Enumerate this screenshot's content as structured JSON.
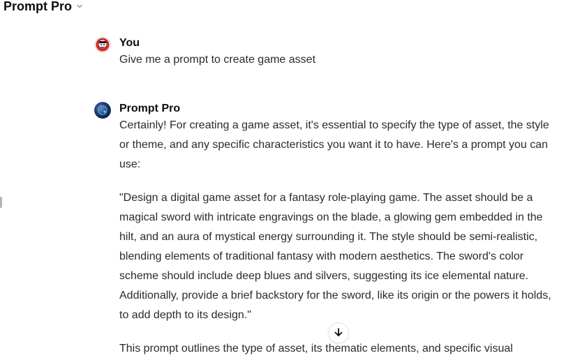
{
  "header": {
    "model_name": "Prompt Pro"
  },
  "messages": {
    "user": {
      "author": "You",
      "text": "Give me a prompt to create game asset"
    },
    "assistant": {
      "author": "Prompt Pro",
      "paragraphs": [
        "Certainly! For creating a game asset, it's essential to specify the type of asset, the style or theme, and any specific characteristics you want it to have. Here's a prompt you can use:",
        "\"Design a digital game asset for a fantasy role-playing game. The asset should be a magical sword with intricate engravings on the blade, a glowing gem embedded in the hilt, and an aura of mystical energy surrounding it. The style should be semi-realistic, blending elements of traditional fantasy with modern aesthetics. The sword's color scheme should include deep blues and silvers, suggesting its ice elemental nature. Additionally, provide a brief backstory for the sword, like its origin or the powers it holds, to add depth to its design.\"",
        "This prompt outlines the type of asset, its thematic elements, and specific visual"
      ]
    }
  },
  "icons": {
    "header_chevron": "chevron-down-icon",
    "scroll_button": "arrow-down-icon",
    "user_avatar": "user-avatar",
    "assistant_avatar": "assistant-avatar"
  }
}
